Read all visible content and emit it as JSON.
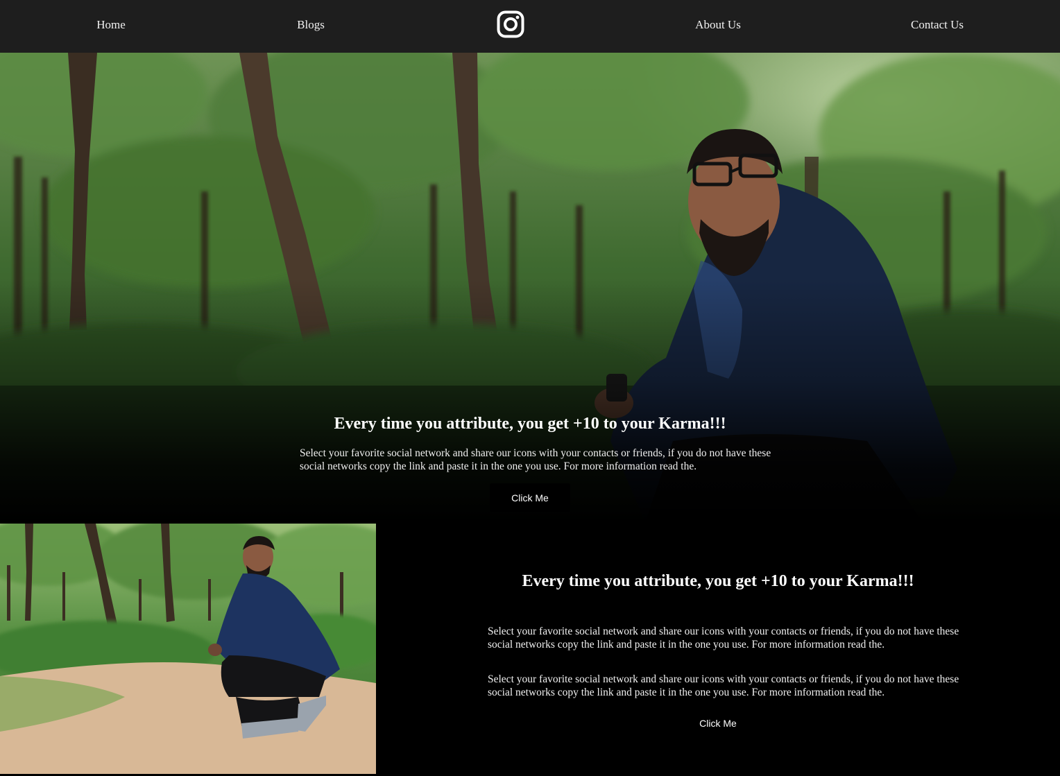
{
  "nav": {
    "links": [
      "Home",
      "Blogs",
      "About Us",
      "Contact Us"
    ],
    "logo_icon": "instagram-icon"
  },
  "hero": {
    "title": "Every time you attribute, you get +10 to your Karma!!!",
    "text": "Select your favorite social network and share our icons with your contacts or friends, if you do not have these social networks copy the link and paste it in the one you use. For more information read the.",
    "button_label": "Click Me"
  },
  "feature": {
    "title": "Every time you attribute, you get +10 to your Karma!!!",
    "paragraph_1": "Select your favorite social network and share our icons with your contacts or friends, if you do not have these social networks copy the link and paste it in the one you use. For more information read the.",
    "paragraph_2": "Select your favorite social network and share our icons with your contacts or friends, if you do not have these social networks copy the link and paste it in the one you use. For more information read the.",
    "button_label": "Click Me"
  },
  "colors": {
    "navbar_bg": "#1e1e1e",
    "page_bg": "#000000",
    "text": "#ffffff"
  }
}
